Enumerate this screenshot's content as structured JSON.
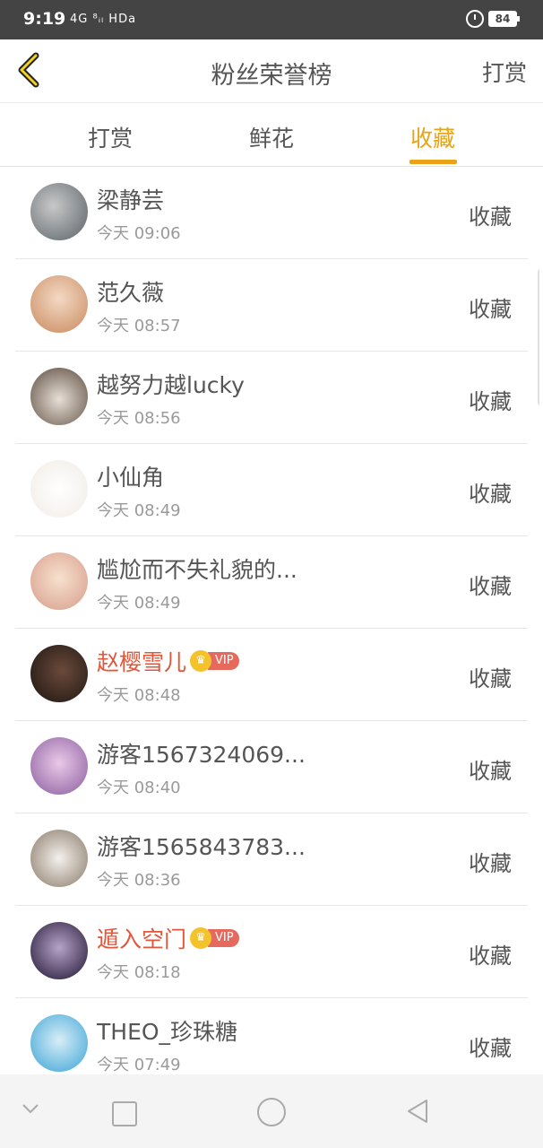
{
  "status_bar": {
    "time": "9:19",
    "signal": "4G ⁸ᵢₗ HDa",
    "battery": "84"
  },
  "header": {
    "title": "粉丝荣誉榜",
    "right_action": "打赏"
  },
  "tabs": [
    {
      "label": "打赏",
      "active": false
    },
    {
      "label": "鲜花",
      "active": false
    },
    {
      "label": "收藏",
      "active": true
    }
  ],
  "colors": {
    "accent": "#e8a317",
    "vip_name": "#e0573b",
    "vip_tag": "#e56a5d",
    "crown": "#f4c22b"
  },
  "rows": [
    {
      "name": "梁静芸",
      "time": "今天 09:06",
      "action": "收藏",
      "vip": false
    },
    {
      "name": "范久薇",
      "time": "今天 08:57",
      "action": "收藏",
      "vip": false
    },
    {
      "name": "越努力越lucky",
      "time": "今天 08:56",
      "action": "收藏",
      "vip": false
    },
    {
      "name": "小仙角",
      "time": "今天 08:49",
      "action": "收藏",
      "vip": false
    },
    {
      "name": "尴尬而不失礼貌的...",
      "time": "今天 08:49",
      "action": "收藏",
      "vip": false
    },
    {
      "name": "赵樱雪儿",
      "time": "今天 08:48",
      "action": "收藏",
      "vip": true,
      "vip_label": "VIP"
    },
    {
      "name": "游客1567324069...",
      "time": "今天 08:40",
      "action": "收藏",
      "vip": false
    },
    {
      "name": "游客1565843783...",
      "time": "今天 08:36",
      "action": "收藏",
      "vip": false
    },
    {
      "name": "遁入空门",
      "time": "今天 08:18",
      "action": "收藏",
      "vip": true,
      "vip_label": "VIP"
    },
    {
      "name": "THEO_珍珠糖",
      "time": "今天 07:49",
      "action": "收藏",
      "vip": false
    }
  ]
}
